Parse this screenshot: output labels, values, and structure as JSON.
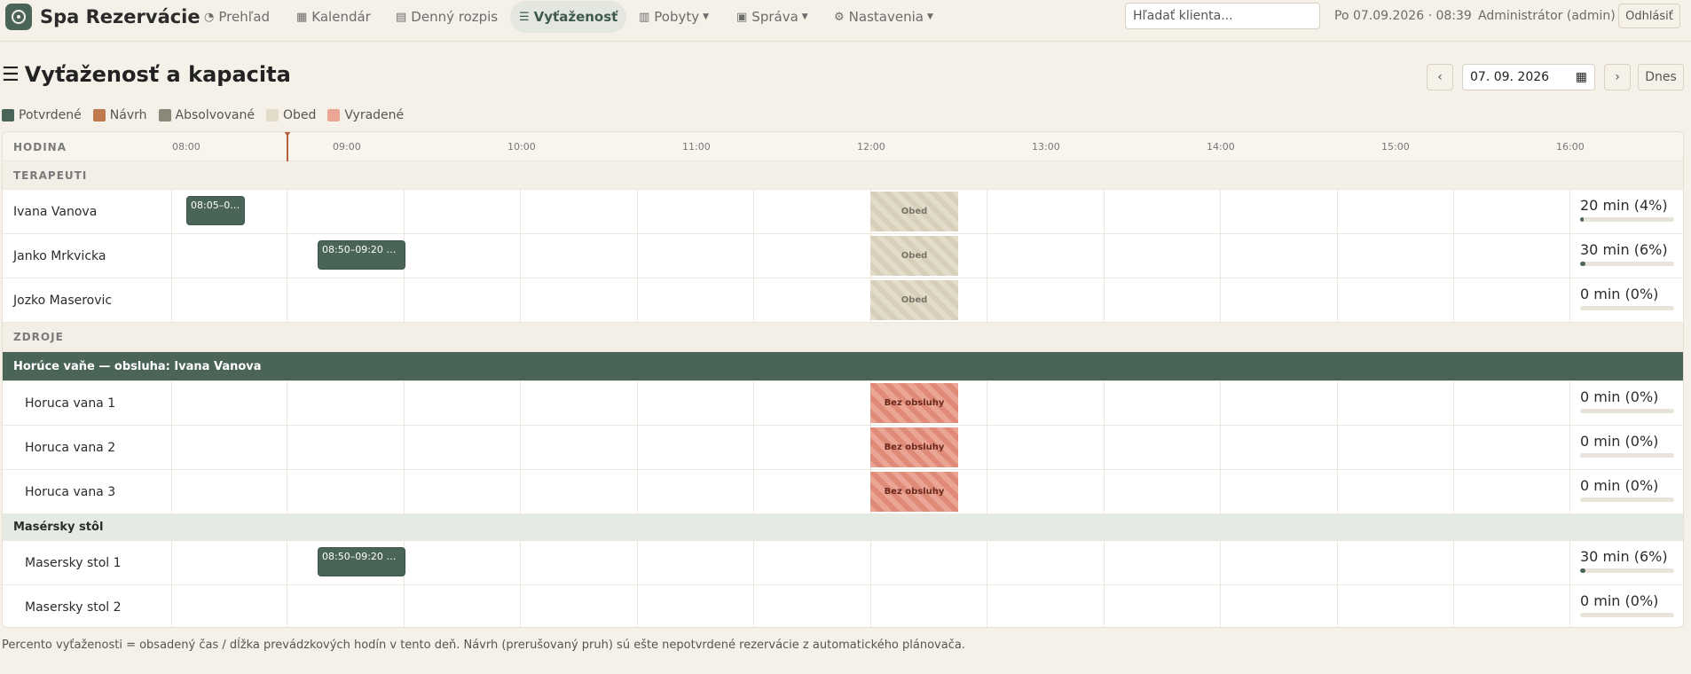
{
  "app": {
    "title": "Spa Rezervácie"
  },
  "nav": {
    "items": [
      {
        "label": "Prehľad",
        "icon": "gauge-icon"
      },
      {
        "label": "Kalendár",
        "icon": "calendar-icon"
      },
      {
        "label": "Denný rozpis",
        "icon": "grid-icon"
      },
      {
        "label": "Vyťaženosť",
        "icon": "bars-icon",
        "active": true
      },
      {
        "label": "Pobyty",
        "icon": "suitcase-icon",
        "dropdown": true
      },
      {
        "label": "Správa",
        "icon": "clipboard-icon",
        "dropdown": true
      },
      {
        "label": "Nastavenia",
        "icon": "gear-icon",
        "dropdown": true
      }
    ]
  },
  "search": {
    "placeholder": "Hľadať klienta..."
  },
  "header": {
    "datetime": "Po 07.09.2026 · 08:39",
    "user": "Administrátor (admin)",
    "logout_label": "Odhlásiť"
  },
  "page": {
    "title": "Vyťaženosť a kapacita",
    "date_value": "07. 09. 2026",
    "today_label": "Dnes"
  },
  "legend": [
    {
      "label": "Potvrdené",
      "color": "#4a6558"
    },
    {
      "label": "Návrh",
      "color": "#c07a50"
    },
    {
      "label": "Absolvované",
      "color": "#8a8878"
    },
    {
      "label": "Obed",
      "color": "#e4dccb"
    },
    {
      "label": "Vyradené",
      "color": "#eaa595"
    }
  ],
  "grid": {
    "hour_header": "HODINA",
    "hours": [
      "08:00",
      "09:00",
      "10:00",
      "11:00",
      "12:00",
      "13:00",
      "14:00",
      "15:00",
      "16:00"
    ],
    "now_time": "08:39",
    "sections": {
      "therapists": "TERAPEUTI",
      "resources": "ZDROJE"
    },
    "therapists": [
      {
        "name": "Ivana Vanova",
        "booking": {
          "label": "08:05–0…",
          "start": "08:05",
          "end": "08:25"
        },
        "lunch_label": "Obed",
        "util": "20 min (4%)",
        "util_pct": 4
      },
      {
        "name": "Janko Mrkvicka",
        "booking": {
          "label": "08:50–09:20 Z…",
          "start": "08:50",
          "end": "09:20"
        },
        "lunch_label": "Obed",
        "util": "30 min (6%)",
        "util_pct": 6
      },
      {
        "name": "Jozko Maserovic",
        "lunch_label": "Obed",
        "util": "0 min (0%)",
        "util_pct": 0
      }
    ],
    "groups": [
      {
        "label": "Horúce vaňe — obsluha: Ivana Vanova",
        "style": "dark",
        "items": [
          {
            "name": "Horuca vana 1",
            "blocked_label": "Bez obsluhy",
            "util": "0 min (0%)",
            "util_pct": 0
          },
          {
            "name": "Horuca vana 2",
            "blocked_label": "Bez obsluhy",
            "util": "0 min (0%)",
            "util_pct": 0
          },
          {
            "name": "Horuca vana 3",
            "blocked_label": "Bez obsluhy",
            "util": "0 min (0%)",
            "util_pct": 0
          }
        ]
      },
      {
        "label": "Masérsky stôl",
        "style": "light",
        "items": [
          {
            "name": "Masersky stol 1",
            "booking": {
              "label": "08:50–09:20 Z…",
              "start": "08:50",
              "end": "09:20"
            },
            "util": "30 min (6%)",
            "util_pct": 6
          },
          {
            "name": "Masersky stol 2",
            "util": "0 min (0%)",
            "util_pct": 0
          }
        ]
      }
    ]
  },
  "footnote": "Percento vyťaženosti = obsadený čas / dĺžka prevádzkových hodín v tento deň. Návrh (prerušovaný pruh) sú ešte nepotvrdené rezervácie z automatického plánovača."
}
